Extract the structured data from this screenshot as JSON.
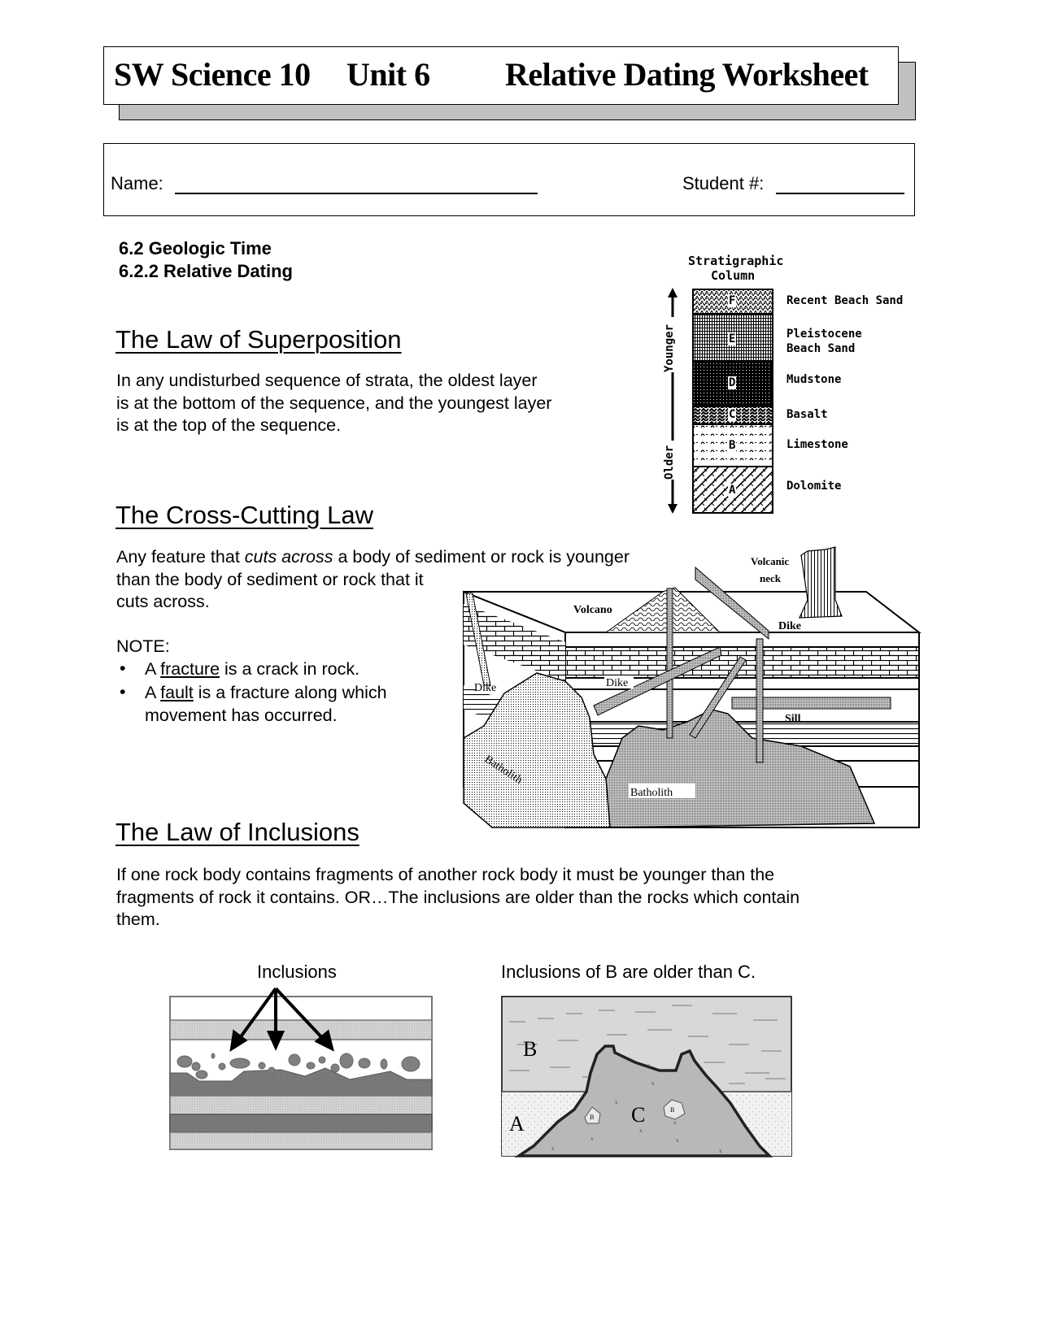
{
  "header": {
    "course": "SW Science 10",
    "unit": "Unit 6",
    "title": "Relative Dating Worksheet"
  },
  "student_fields": {
    "name_label": "Name:",
    "name_value": "",
    "student_number_label": "Student #:",
    "student_number_value": ""
  },
  "sections": {
    "heading1": "6.2  Geologic Time",
    "heading2": "6.2.2  Relative Dating"
  },
  "superposition": {
    "title": "The Law of Superposition",
    "lines": [
      "In any undisturbed sequence of strata, the oldest layer",
      "is at the bottom of the sequence, and the youngest layer",
      "is at the top of the sequence."
    ]
  },
  "strat_column": {
    "title_line1": "Stratigraphic",
    "title_line2": "Column",
    "axis_top": "Younger",
    "axis_bottom": "Older",
    "layers": [
      {
        "letter": "F",
        "name": "Recent Beach Sand"
      },
      {
        "letter": "E",
        "name_line1": "Pleistocene",
        "name_line2": "Beach Sand"
      },
      {
        "letter": "D",
        "name": "Mudstone"
      },
      {
        "letter": "C",
        "name": "Basalt"
      },
      {
        "letter": "B",
        "name": "Limestone"
      },
      {
        "letter": "A",
        "name": "Dolomite"
      }
    ]
  },
  "cross_cutting": {
    "title": "The Cross-Cutting Law",
    "line1_pre": "Any feature that ",
    "line1_em": "cuts across",
    "line1_post": " a body of sediment or rock is younger",
    "line2": "than the body of sediment or rock that it",
    "line3": "cuts across.",
    "note_label": "NOTE:",
    "bullets": [
      {
        "pre": "A ",
        "term": "fracture",
        "post": " is a crack in rock."
      },
      {
        "pre": "A ",
        "term": "fault",
        "post": " is a fracture along which",
        "cont": "movement has occurred."
      }
    ],
    "bullet_glyph": "•"
  },
  "block_diagram": {
    "labels": {
      "volcano": "Volcano",
      "volcanic_neck_1": "Volcanic",
      "volcanic_neck_2": "neck",
      "dike_right": "Dike",
      "dike_left": "Dike",
      "dike_center": "Dike",
      "sill": "Sill",
      "batholith_left": "Batholith",
      "batholith_right": "Batholith"
    }
  },
  "inclusions": {
    "title": "The Law of Inclusions",
    "lines": [
      "If one rock body contains fragments of another rock body it must be younger than the",
      "fragments of rock it contains. OR…The inclusions are older than the rocks which contain",
      "them."
    ],
    "fig1_caption": "Inclusions",
    "fig2_caption": "Inclusions of B are older than C.",
    "fig2_labels": {
      "b": "B",
      "a": "A",
      "c": "C",
      "inc": "B"
    }
  }
}
